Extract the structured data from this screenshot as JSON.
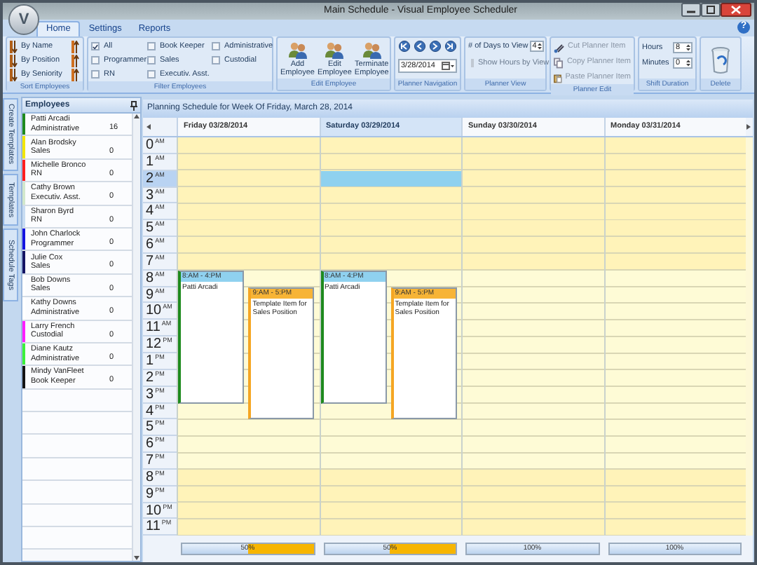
{
  "window": {
    "title": "Main Schedule - Visual Employee Scheduler",
    "logo": "V"
  },
  "ribbon_tabs": [
    {
      "label": "Home",
      "selected": true
    },
    {
      "label": "Settings",
      "selected": false
    },
    {
      "label": "Reports",
      "selected": false
    }
  ],
  "help": "?",
  "ribbon": {
    "sort_employees": {
      "label": "Sort Employees",
      "items": [
        "By Name",
        "By Position",
        "By Seniority"
      ]
    },
    "filter_employees": {
      "label": "Filter Employees",
      "options": [
        {
          "label": "All",
          "checked": true
        },
        {
          "label": "Programmer",
          "checked": false
        },
        {
          "label": "RN",
          "checked": false
        },
        {
          "label": "Book Keeper",
          "checked": false
        },
        {
          "label": "Sales",
          "checked": false
        },
        {
          "label": "Executiv. Asst.",
          "checked": false
        },
        {
          "label": "Administrative",
          "checked": false
        },
        {
          "label": "Custodial",
          "checked": false
        }
      ]
    },
    "edit_employee": {
      "label": "Edit Employee",
      "buttons": [
        "Add Employee",
        "Edit Employee",
        "Terminate Employee"
      ]
    },
    "planner_navigation": {
      "label": "Planner Navigation",
      "date": "3/28/2014"
    },
    "planner_view": {
      "label": "Planner View",
      "days_label": "# of Days to View",
      "days_value": "4",
      "show_hours": {
        "label": "Show Hours by View",
        "checked": false,
        "disabled": true
      }
    },
    "planner_edit": {
      "label": "Planner Edit",
      "items": [
        {
          "label": "Cut Planner Item",
          "disabled": true
        },
        {
          "label": "Copy Planner Item",
          "disabled": true
        },
        {
          "label": "Paste Planner Item",
          "disabled": true
        }
      ]
    },
    "shift_duration": {
      "label": "Shift Duration",
      "hours_label": "Hours",
      "hours": "8",
      "minutes_label": "Minutes",
      "minutes": "0"
    },
    "delete": {
      "label": "Delete"
    }
  },
  "side_tabs": [
    "Create Templates",
    "Templates",
    "Schedule Tags"
  ],
  "employees": {
    "title": "Employees",
    "items": [
      {
        "name": "Patti Arcadi",
        "role": "Administrative",
        "count": "16",
        "color": "#1e8a1e"
      },
      {
        "name": "Alan Brodsky",
        "role": "Sales",
        "count": "0",
        "color": "#f2e600"
      },
      {
        "name": "Michelle Bronco",
        "role": "RN",
        "count": "0",
        "color": "#ff1e1e"
      },
      {
        "name": "Cathy Brown",
        "role": "Executiv. Asst.",
        "count": "0",
        "color": "#d2e8cc"
      },
      {
        "name": "Sharon Byrd",
        "role": "RN",
        "count": "0",
        "color": "#c8dcf2"
      },
      {
        "name": "John Charlock",
        "role": "Programmer",
        "count": "0",
        "color": "#1414e0"
      },
      {
        "name": "Julie Cox",
        "role": "Sales",
        "count": "0",
        "color": "#141464"
      },
      {
        "name": "Bob Downs",
        "role": "Sales",
        "count": "0",
        "color": "#ffffff"
      },
      {
        "name": "Kathy Downs",
        "role": "Administrative",
        "count": "0",
        "color": "#ffffff"
      },
      {
        "name": "Larry French",
        "role": "Custodial",
        "count": "0",
        "color": "#ff1eff"
      },
      {
        "name": "Diane Kautz",
        "role": "Administrative",
        "count": "0",
        "color": "#3cf03c"
      },
      {
        "name": "Mindy VanFleet",
        "role": "Book Keeper",
        "count": "0",
        "color": "#141414"
      }
    ]
  },
  "planner": {
    "title": "Planning Schedule for Week Of Friday, March 28, 2014",
    "hour_groups": [
      {
        "working": false,
        "hours": [
          {
            "hour": "0",
            "suffix": "AM",
            "selected": false
          },
          {
            "hour": "1",
            "suffix": "AM",
            "selected": false
          },
          {
            "hour": "2",
            "suffix": "AM",
            "selected": true
          },
          {
            "hour": "3",
            "suffix": "AM",
            "selected": false
          },
          {
            "hour": "4",
            "suffix": "AM",
            "selected": false
          },
          {
            "hour": "5",
            "suffix": "AM",
            "selected": false
          },
          {
            "hour": "6",
            "suffix": "AM",
            "selected": false
          },
          {
            "hour": "7",
            "suffix": "AM",
            "selected": false
          }
        ]
      },
      {
        "working": true,
        "hours": [
          {
            "hour": "8",
            "suffix": "AM",
            "selected": false
          },
          {
            "hour": "9",
            "suffix": "AM",
            "selected": false
          },
          {
            "hour": "10",
            "suffix": "AM",
            "selected": false
          },
          {
            "hour": "11",
            "suffix": "AM",
            "selected": false
          },
          {
            "hour": "12",
            "suffix": "PM",
            "selected": false
          },
          {
            "hour": "1",
            "suffix": "PM",
            "selected": false
          },
          {
            "hour": "2",
            "suffix": "PM",
            "selected": false
          },
          {
            "hour": "3",
            "suffix": "PM",
            "selected": false
          },
          {
            "hour": "4",
            "suffix": "PM",
            "selected": false
          },
          {
            "hour": "5",
            "suffix": "PM",
            "selected": false
          },
          {
            "hour": "6",
            "suffix": "PM",
            "selected": false
          },
          {
            "hour": "7",
            "suffix": "PM",
            "selected": false
          }
        ]
      },
      {
        "working": false,
        "hours": [
          {
            "hour": "8",
            "suffix": "PM",
            "selected": false
          },
          {
            "hour": "9",
            "suffix": "PM",
            "selected": false
          },
          {
            "hour": "10",
            "suffix": "PM",
            "selected": false
          },
          {
            "hour": "11",
            "suffix": "PM",
            "selected": false
          }
        ]
      }
    ],
    "days": [
      {
        "label": "Friday 03/28/2014",
        "selected": false,
        "coverage": "50%",
        "level": 0.5,
        "events": [
          {
            "kind": "shift",
            "time": "8:AM - 4:PM",
            "title": "Patti Arcadi",
            "color": "#1e8a1e"
          },
          {
            "kind": "template",
            "time": "9:AM - 5:PM",
            "title": "Template Item for Sales Position",
            "color": "#f5a623"
          }
        ]
      },
      {
        "label": "Saturday 03/29/2014",
        "selected": true,
        "coverage": "50%",
        "level": 0.5,
        "events": [
          {
            "kind": "shift",
            "time": "8:AM - 4:PM",
            "title": "Patti Arcadi",
            "color": "#1e8a1e"
          },
          {
            "kind": "template",
            "time": "9:AM - 5:PM",
            "title": "Template Item for Sales Position",
            "color": "#f5a623"
          }
        ]
      },
      {
        "label": "Sunday 03/30/2014",
        "selected": false,
        "coverage": "100%",
        "level": 1
      },
      {
        "label": "Monday 03/31/2014",
        "selected": false,
        "coverage": "100%",
        "level": 1
      }
    ]
  }
}
